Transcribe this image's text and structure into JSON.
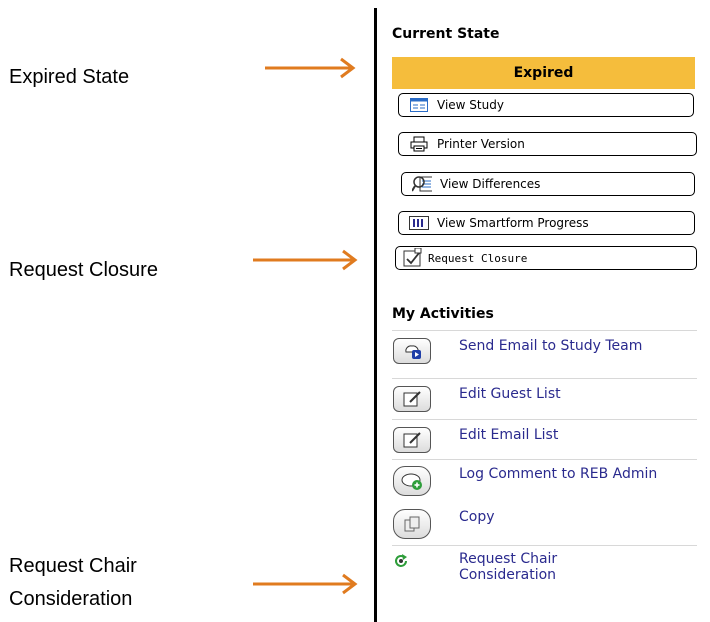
{
  "annotations": {
    "expired_state": "Expired State",
    "request_closure": "Request Closure",
    "request_chair_line1": "Request Chair",
    "request_chair_line2": "Consideration"
  },
  "panel": {
    "current_state_title": "Current State",
    "state_value": "Expired",
    "state_color": "#f5bd3c",
    "buttons": [
      {
        "label": "View Study",
        "icon": "study-window-icon"
      },
      {
        "label": "Printer Version",
        "icon": "printer-icon"
      },
      {
        "label": "View Differences",
        "icon": "differences-icon"
      },
      {
        "label": "View Smartform Progress",
        "icon": "progress-icon"
      },
      {
        "label": "Request Closure",
        "icon": "closure-icon"
      }
    ],
    "activities_title": "My Activities",
    "activities": [
      {
        "label": "Send Email to Study Team",
        "icon": "send-email-icon"
      },
      {
        "label": "Edit Guest List",
        "icon": "edit-icon"
      },
      {
        "label": "Edit Email List",
        "icon": "edit-icon"
      },
      {
        "label": "Log Comment to REB Admin",
        "icon": "comment-icon"
      },
      {
        "label": "Copy",
        "icon": "copy-icon"
      },
      {
        "label": "Request Chair Consideration",
        "icon": "chair-refresh-icon"
      }
    ]
  },
  "colors": {
    "arrow": "#e07b1f",
    "link": "#2a2a8e"
  }
}
